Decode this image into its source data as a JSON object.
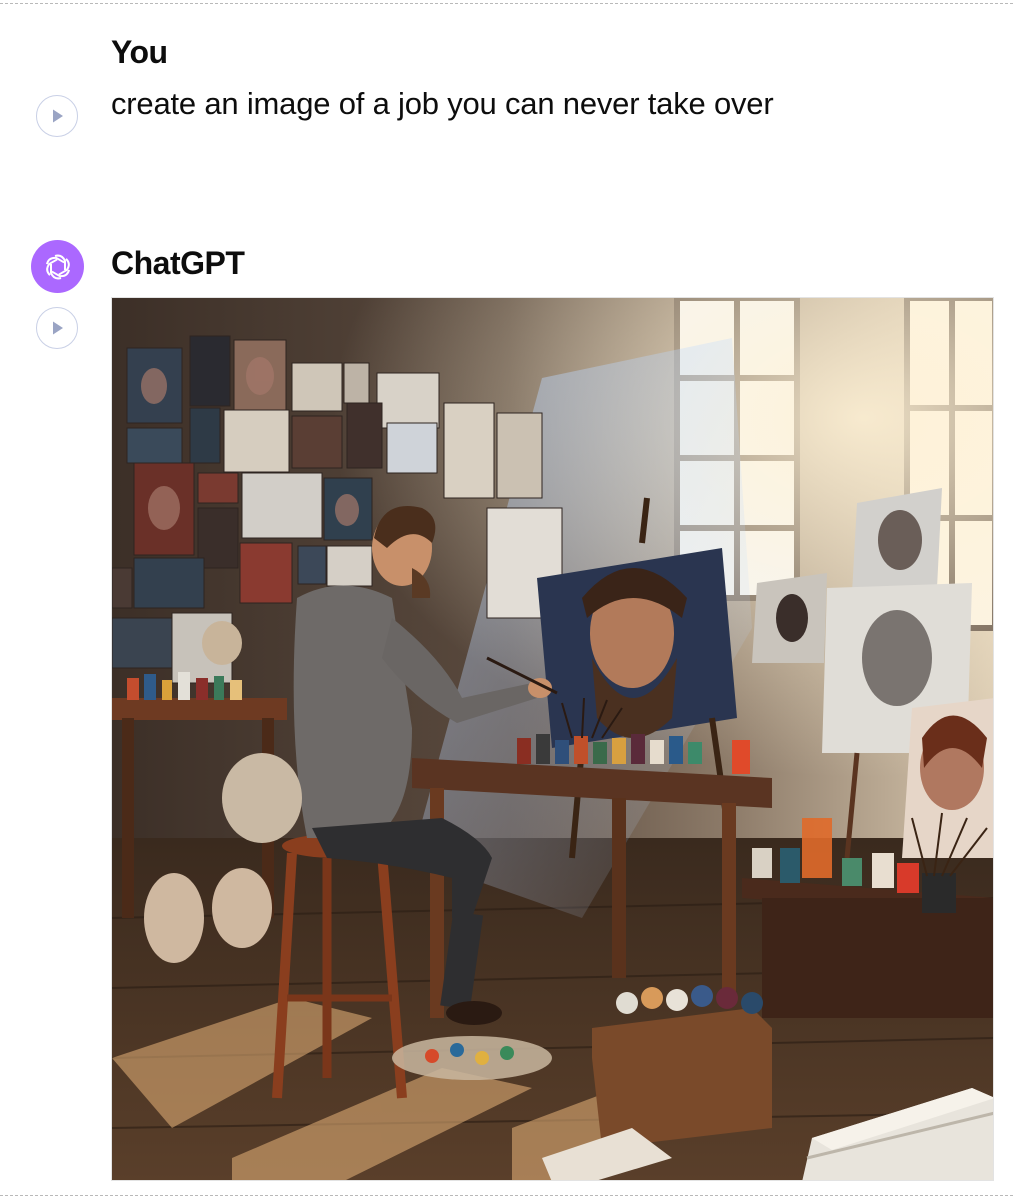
{
  "conversation": {
    "user_turn": {
      "sender": "You",
      "message": "create an image of a job you can never take over"
    },
    "assistant_turn": {
      "sender": "ChatGPT"
    }
  },
  "icons": {
    "play": "play-icon",
    "avatar": "openai-logo-icon"
  },
  "colors": {
    "avatar_bg": "#ab68ff",
    "play_button_border": "#c9d0e6",
    "play_triangle": "#9aa4c4",
    "text": "#0d0d0d"
  },
  "generated_image": {
    "subject": "painter-in-sunlit-studio"
  }
}
